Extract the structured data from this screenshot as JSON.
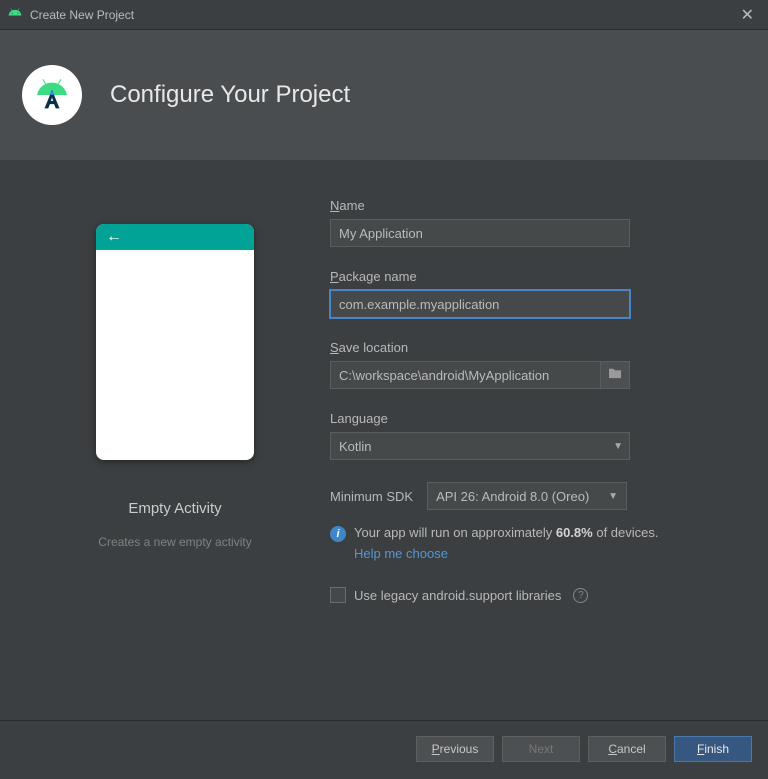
{
  "window": {
    "title": "Create New Project"
  },
  "header": {
    "title": "Configure Your Project"
  },
  "preview": {
    "title": "Empty Activity",
    "subtitle": "Creates a new empty activity"
  },
  "form": {
    "name": {
      "label_rest": "ame",
      "value": "My Application"
    },
    "package": {
      "label_rest": "ackage name",
      "value": "com.example.myapplication"
    },
    "save": {
      "label_rest": "ave location",
      "value": "C:\\workspace\\android\\MyApplication"
    },
    "language": {
      "label": "Language",
      "value": "Kotlin"
    },
    "sdk": {
      "label": "Minimum SDK",
      "value": "API 26: Android 8.0 (Oreo)"
    },
    "info": {
      "pre": "Your app will run on approximately ",
      "pct": "60.8%",
      "post": " of devices.",
      "help": "Help me choose"
    },
    "legacy": {
      "label": "Use legacy android.support libraries"
    }
  },
  "footer": {
    "previous": "revious",
    "next": "Next",
    "cancel": "ancel",
    "finish": "inish"
  }
}
